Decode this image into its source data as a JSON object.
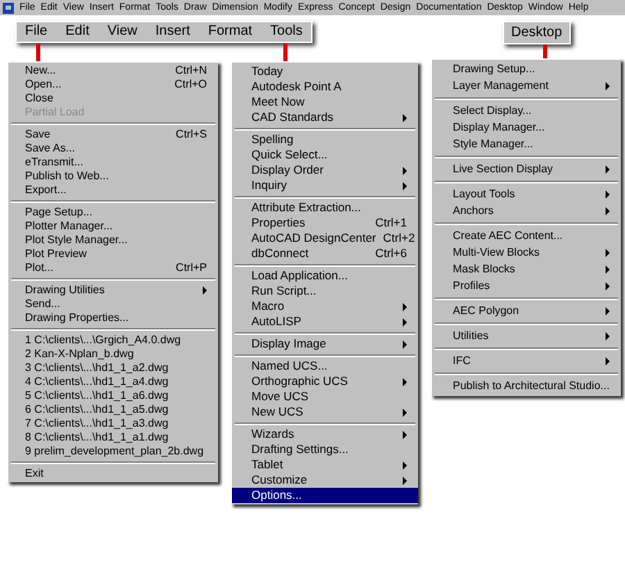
{
  "menubar": {
    "items": [
      "File",
      "Edit",
      "View",
      "Insert",
      "Format",
      "Tools",
      "Draw",
      "Dimension",
      "Modify",
      "Express",
      "Concept",
      "Design",
      "Documentation",
      "Desktop",
      "Window",
      "Help"
    ]
  },
  "callout_bar": {
    "items": [
      "File",
      "Edit",
      "View",
      "Insert",
      "Format",
      "Tools"
    ]
  },
  "desktop_callout": {
    "label": "Desktop"
  },
  "file_menu": {
    "sections": [
      [
        {
          "label": "New...",
          "shortcut": "Ctrl+N",
          "submenu": false,
          "disabled": false
        },
        {
          "label": "Open...",
          "shortcut": "Ctrl+O",
          "submenu": false,
          "disabled": false
        },
        {
          "label": "Close",
          "submenu": false,
          "disabled": false
        },
        {
          "label": "Partial Load",
          "submenu": false,
          "disabled": true
        }
      ],
      [
        {
          "label": "Save",
          "shortcut": "Ctrl+S",
          "submenu": false,
          "disabled": false
        },
        {
          "label": "Save As...",
          "submenu": false,
          "disabled": false
        },
        {
          "label": "eTransmit...",
          "submenu": false,
          "disabled": false
        },
        {
          "label": "Publish to Web...",
          "submenu": false,
          "disabled": false
        },
        {
          "label": "Export...",
          "submenu": false,
          "disabled": false
        }
      ],
      [
        {
          "label": "Page Setup...",
          "submenu": false,
          "disabled": false
        },
        {
          "label": "Plotter Manager...",
          "submenu": false,
          "disabled": false
        },
        {
          "label": "Plot Style Manager...",
          "submenu": false,
          "disabled": false
        },
        {
          "label": "Plot Preview",
          "submenu": false,
          "disabled": false
        },
        {
          "label": "Plot...",
          "shortcut": "Ctrl+P",
          "submenu": false,
          "disabled": false
        }
      ],
      [
        {
          "label": "Drawing Utilities",
          "submenu": true,
          "disabled": false
        },
        {
          "label": "Send...",
          "submenu": false,
          "disabled": false
        },
        {
          "label": "Drawing Properties...",
          "submenu": false,
          "disabled": false
        }
      ],
      [
        {
          "label": "1 C:\\clients\\...\\Grgich_A4.0.dwg",
          "submenu": false,
          "disabled": false
        },
        {
          "label": "2 Kan-X-Nplan_b.dwg",
          "submenu": false,
          "disabled": false
        },
        {
          "label": "3 C:\\clients\\...\\hd1_1_a2.dwg",
          "submenu": false,
          "disabled": false
        },
        {
          "label": "4 C:\\clients\\...\\hd1_1_a4.dwg",
          "submenu": false,
          "disabled": false
        },
        {
          "label": "5 C:\\clients\\...\\hd1_1_a6.dwg",
          "submenu": false,
          "disabled": false
        },
        {
          "label": "6 C:\\clients\\...\\hd1_1_a5.dwg",
          "submenu": false,
          "disabled": false
        },
        {
          "label": "7 C:\\clients\\...\\hd1_1_a3.dwg",
          "submenu": false,
          "disabled": false
        },
        {
          "label": "8 C:\\clients\\...\\hd1_1_a1.dwg",
          "submenu": false,
          "disabled": false
        },
        {
          "label": "9 prelim_development_plan_2b.dwg",
          "submenu": false,
          "disabled": false
        }
      ],
      [
        {
          "label": "Exit",
          "submenu": false,
          "disabled": false
        }
      ]
    ]
  },
  "tools_menu": {
    "sections": [
      [
        {
          "label": "Today",
          "submenu": false,
          "selected": false
        },
        {
          "label": "Autodesk Point A",
          "submenu": false,
          "selected": false
        },
        {
          "label": "Meet Now",
          "submenu": false,
          "selected": false
        },
        {
          "label": "CAD Standards",
          "submenu": true,
          "selected": false
        }
      ],
      [
        {
          "label": "Spelling",
          "submenu": false,
          "selected": false
        },
        {
          "label": "Quick Select...",
          "submenu": false,
          "selected": false
        },
        {
          "label": "Display Order",
          "submenu": true,
          "selected": false
        },
        {
          "label": "Inquiry",
          "submenu": true,
          "selected": false
        }
      ],
      [
        {
          "label": "Attribute Extraction...",
          "submenu": false,
          "selected": false
        },
        {
          "label": "Properties",
          "shortcut": "Ctrl+1",
          "submenu": false,
          "selected": false
        },
        {
          "label": "AutoCAD DesignCenter",
          "shortcut": "Ctrl+2",
          "submenu": false,
          "selected": false
        },
        {
          "label": "dbConnect",
          "shortcut": "Ctrl+6",
          "submenu": false,
          "selected": false
        }
      ],
      [
        {
          "label": "Load Application...",
          "submenu": false,
          "selected": false
        },
        {
          "label": "Run Script...",
          "submenu": false,
          "selected": false
        },
        {
          "label": "Macro",
          "submenu": true,
          "selected": false
        },
        {
          "label": "AutoLISP",
          "submenu": true,
          "selected": false
        }
      ],
      [
        {
          "label": "Display Image",
          "submenu": true,
          "selected": false
        }
      ],
      [
        {
          "label": "Named UCS...",
          "submenu": false,
          "selected": false
        },
        {
          "label": "Orthographic UCS",
          "submenu": true,
          "selected": false
        },
        {
          "label": "Move UCS",
          "submenu": false,
          "selected": false
        },
        {
          "label": "New UCS",
          "submenu": true,
          "selected": false
        }
      ],
      [
        {
          "label": "Wizards",
          "submenu": true,
          "selected": false
        },
        {
          "label": "Drafting Settings...",
          "submenu": false,
          "selected": false
        },
        {
          "label": "Tablet",
          "submenu": true,
          "selected": false
        },
        {
          "label": "Customize",
          "submenu": true,
          "selected": false
        },
        {
          "label": "Options...",
          "submenu": false,
          "selected": true
        }
      ]
    ]
  },
  "desktop_menu": {
    "sections": [
      [
        {
          "label": "Drawing Setup...",
          "submenu": false
        },
        {
          "label": "Layer Management",
          "submenu": true
        }
      ],
      [
        {
          "label": "Select Display...",
          "submenu": false
        },
        {
          "label": "Display Manager...",
          "submenu": false
        },
        {
          "label": "Style Manager...",
          "submenu": false
        }
      ],
      [
        {
          "label": "Live Section Display",
          "submenu": true
        }
      ],
      [
        {
          "label": "Layout Tools",
          "submenu": true
        },
        {
          "label": "Anchors",
          "submenu": true
        }
      ],
      [
        {
          "label": "Create AEC Content...",
          "submenu": false
        },
        {
          "label": "Multi-View Blocks",
          "submenu": true
        },
        {
          "label": "Mask Blocks",
          "submenu": true
        },
        {
          "label": "Profiles",
          "submenu": true
        }
      ],
      [
        {
          "label": "AEC Polygon",
          "submenu": true
        }
      ],
      [
        {
          "label": "Utilities",
          "submenu": true
        }
      ],
      [
        {
          "label": "IFC",
          "submenu": true
        }
      ],
      [
        {
          "label": "Publish to Architectural Studio...",
          "submenu": false
        }
      ]
    ]
  }
}
